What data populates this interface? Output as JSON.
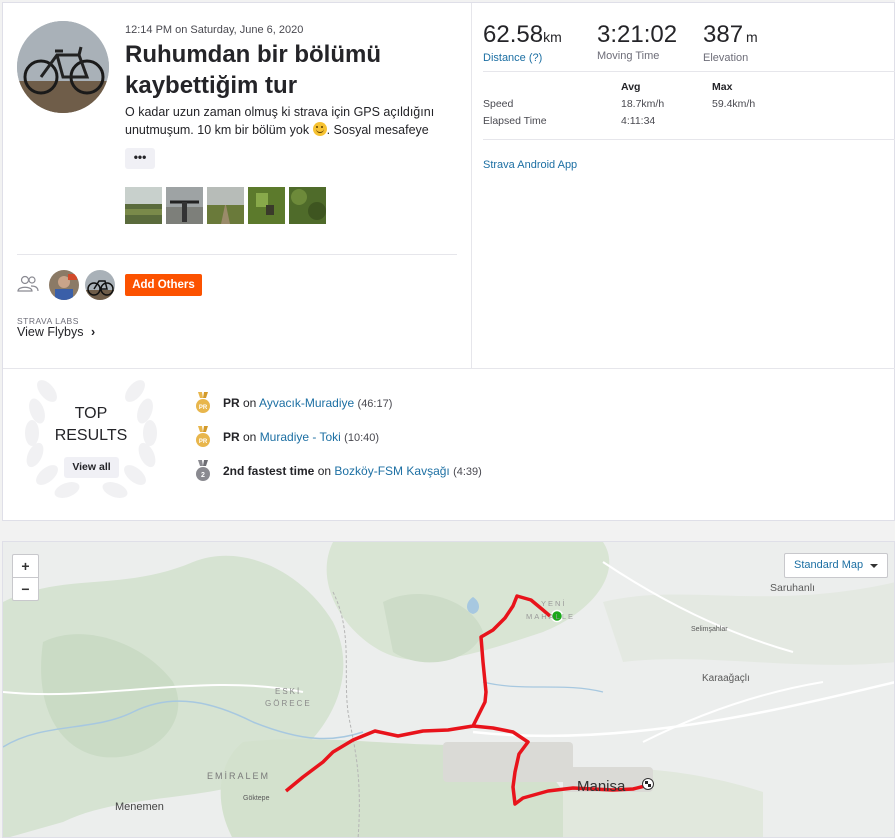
{
  "activity": {
    "meta": "12:14 PM on Saturday, June 6, 2020",
    "title": "Ruhumdan bir bölümü kaybettiğim tur",
    "description_line1": "O kadar uzun zaman olmuş ki strava için GPS açıldığını",
    "description_line2": "unutmuşum. 10 km bir bölüm yok",
    "description_line2b": ". Sosyal mesafeye",
    "more_label": "•••",
    "emoji_icon": "smiley-icon",
    "photos": [
      "photo-1",
      "photo-2",
      "photo-3",
      "photo-4",
      "photo-5"
    ],
    "add_others_label": "Add Others",
    "labs_label": "STRAVA LABS",
    "flybys_label": "View Flybys",
    "flybys_chevron": "›"
  },
  "stats": {
    "distance": {
      "value": "62.58",
      "unit": "km",
      "label": "Distance (?)"
    },
    "moving_time": {
      "value": "3:21:02",
      "label": "Moving Time"
    },
    "elevation": {
      "value": "387",
      "unit": "m",
      "label": "Elevation"
    },
    "table": {
      "avg_header": "Avg",
      "max_header": "Max",
      "rows": [
        {
          "label": "Speed",
          "avg": "18.7km/h",
          "max": "59.4km/h"
        },
        {
          "label": "Elapsed Time",
          "avg": "4:11:34",
          "max": ""
        }
      ]
    },
    "device_link": "Strava Android App"
  },
  "top_results": {
    "title_line1": "TOP",
    "title_line2": "RESULTS",
    "view_all_label": "View all",
    "achievements": [
      {
        "prefix": "PR",
        "middle": " on ",
        "segment": "Ayvacık-Muradiye",
        "time": "(46:17)",
        "medal": "gold-medal-icon"
      },
      {
        "prefix": "PR",
        "middle": " on ",
        "segment": "Muradiye - Toki",
        "time": "(10:40)",
        "medal": "gold-medal-icon"
      },
      {
        "prefix": "2nd fastest time",
        "middle": " on ",
        "segment": "Bozköy-FSM Kavşağı",
        "time": "(4:39)",
        "medal": "silver-medal-icon"
      }
    ]
  },
  "map": {
    "zoom_in": "+",
    "zoom_out": "−",
    "type_label": "Standard Map",
    "places": {
      "saruhanli": "Saruhanlı",
      "selimsahlar": "Selimşahlar",
      "karaagacli": "Karaağaçlı",
      "yeni_1": "YENİ",
      "yeni_2": "MAHALLE",
      "eski_1": "ESKİ",
      "eski_2": "GÖRECE",
      "emiralem": "EMİRALEM",
      "goktepe": "Göktepe",
      "menemen": "Menemen",
      "manisa": "Manisa"
    },
    "route_color": "#e8131b",
    "start_color": "#1aa81a"
  },
  "colors": {
    "accent": "#fc5200",
    "link": "#1c6fa3",
    "medal_gold": "#e8b64c",
    "medal_silver": "#8a8a90"
  }
}
